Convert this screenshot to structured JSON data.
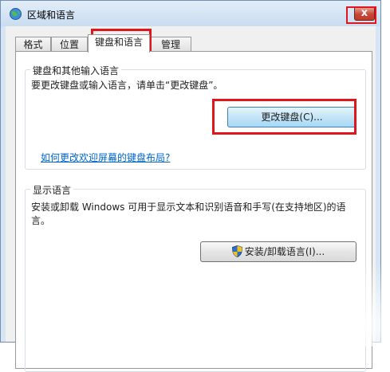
{
  "window": {
    "title": "区域和语言",
    "close_glyph": "x",
    "title_icon": "globe-icon"
  },
  "tabs": [
    {
      "label": "格式",
      "active": false
    },
    {
      "label": "位置",
      "active": false
    },
    {
      "label": "键盘和语言",
      "active": true
    },
    {
      "label": "管理",
      "active": false
    }
  ],
  "keyboard_group": {
    "title": "键盘和其他输入语言",
    "description": "要更改键盘或输入语言，请单击“更改键盘”。",
    "change_button": "更改键盘(C)...",
    "help_link": "如何更改欢迎屏幕的键盘布局?"
  },
  "display_group": {
    "title": "显示语言",
    "description": "安装或卸载 Windows 可用于显示文本和识别语音和手写(在支持地区)的语言。",
    "install_button": "安装/卸载语言(I)...",
    "install_button_icon": "shield-icon"
  },
  "colors": {
    "highlight": "#e0161d",
    "link": "#0066cc",
    "window_frame": "#d6e4f3"
  }
}
